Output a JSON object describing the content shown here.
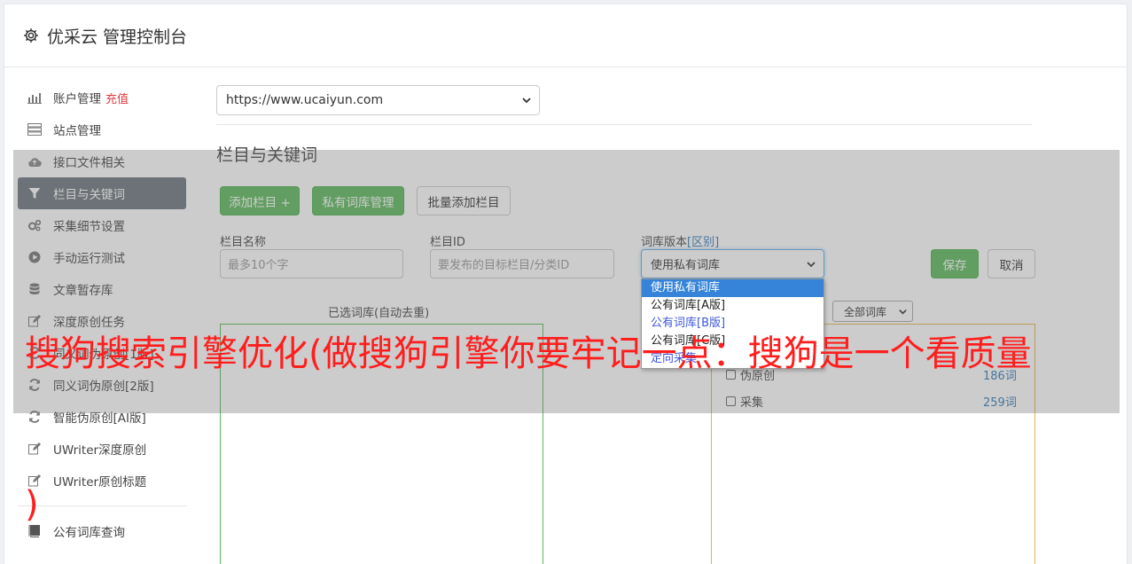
{
  "header": {
    "title": "优采云 管理控制台",
    "icon": "gear-icon"
  },
  "sidebar": {
    "items": [
      {
        "label": "账户管理",
        "badge": "充值",
        "icon": "bar-chart-icon"
      },
      {
        "label": "站点管理",
        "icon": "server-icon"
      },
      {
        "label": "接口文件相关",
        "icon": "cloud-upload-icon"
      },
      {
        "label": "栏目与关键词",
        "icon": "filter-icon",
        "active": true
      },
      {
        "label": "采集细节设置",
        "icon": "cogs-icon"
      },
      {
        "label": "手动运行测试",
        "icon": "play-circle-icon"
      },
      {
        "label": "文章暂存库",
        "icon": "database-icon"
      },
      {
        "label": "深度原创任务",
        "icon": "edit-icon"
      },
      {
        "label": "同义词伪原创[1版]",
        "icon": "refresh-icon"
      },
      {
        "label": "同义词伪原创[2版]",
        "icon": "refresh-icon"
      },
      {
        "label": "智能伪原创[AI版]",
        "icon": "refresh-icon"
      },
      {
        "label": "UWriter深度原创",
        "icon": "edit-icon"
      },
      {
        "label": "UWriter原创标题",
        "icon": "edit-icon"
      },
      {
        "label": "公有词库查询",
        "icon": "book-icon"
      }
    ]
  },
  "main": {
    "site_select": "https://www.ucaiyun.com",
    "section_title": "栏目与关键词",
    "buttons": {
      "add_column": "添加栏目 +",
      "private_lib": "私有词库管理",
      "batch_add": "批量添加栏目",
      "save": "保存",
      "cancel": "取消"
    },
    "form": {
      "name_label": "栏目名称",
      "name_placeholder": "最多10个字",
      "id_label": "栏目ID",
      "id_placeholder": "要发布的目标栏目/分类ID",
      "version_label": "词库版本",
      "version_diff": "[区别]",
      "version_value": "使用私有词库"
    },
    "selected_title": "已选词库(自动去重)",
    "lib_filter": "全部词库",
    "libs": [
      {
        "label": "伪原创",
        "count": "186词"
      },
      {
        "label": "采集",
        "count": "259词"
      }
    ],
    "dropdown_options": [
      {
        "label": "使用私有词库",
        "selected": true
      },
      {
        "label": "公有词库[A版]"
      },
      {
        "label": "公有词库[B版]",
        "link": true
      },
      {
        "label": "公有词库[C版]"
      },
      {
        "label": "定向采集",
        "link": true
      }
    ]
  },
  "overlay_text": {
    "line": "搜狗搜索引擎优化(做搜狗引擎你要牢记一点：搜狗是一个看质量",
    "tail": ")"
  }
}
